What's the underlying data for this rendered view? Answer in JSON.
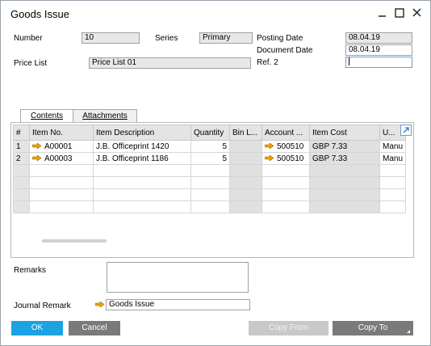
{
  "window": {
    "title": "Goods Issue"
  },
  "header": {
    "number_label": "Number",
    "number_value": "10",
    "series_label": "Series",
    "series_value": "Primary",
    "price_list_label": "Price List",
    "price_list_value": "Price List 01",
    "posting_date_label": "Posting Date",
    "posting_date_value": "08.04.19",
    "document_date_label": "Document Date",
    "document_date_value": "08.04.19",
    "ref2_label": "Ref. 2",
    "ref2_value": ""
  },
  "tabs": [
    {
      "label": "Contents",
      "selected": true
    },
    {
      "label": "Attachments",
      "selected": false
    }
  ],
  "grid": {
    "columns": [
      "#",
      "Item No.",
      "Item Description",
      "Quantity",
      "Bin L...",
      "Account ...",
      "Item Cost",
      "U..."
    ],
    "rows": [
      {
        "no": "1",
        "item_no": "A00001",
        "description": "J.B. Officeprint 1420",
        "quantity": "5",
        "bin": "",
        "account": "500510",
        "cost": "GBP 7.33",
        "uom": "Manu"
      },
      {
        "no": "2",
        "item_no": "A00003",
        "description": "J.B. Officeprint 1186",
        "quantity": "5",
        "bin": "",
        "account": "500510",
        "cost": "GBP 7.33",
        "uom": "Manu"
      }
    ],
    "empty_rows": 4
  },
  "footer": {
    "remarks_label": "Remarks",
    "remarks_value": "",
    "journal_remark_label": "Journal Remark",
    "journal_remark_value": "Goods Issue"
  },
  "buttons": {
    "ok": "OK",
    "cancel": "Cancel",
    "copy_from": "Copy From",
    "copy_to": "Copy To"
  },
  "colors": {
    "ok_button": "#1aa3e0",
    "gray_button": "#7a7a7a",
    "disabled_button": "#c8c8c8",
    "link_arrow": "#f0a000"
  }
}
